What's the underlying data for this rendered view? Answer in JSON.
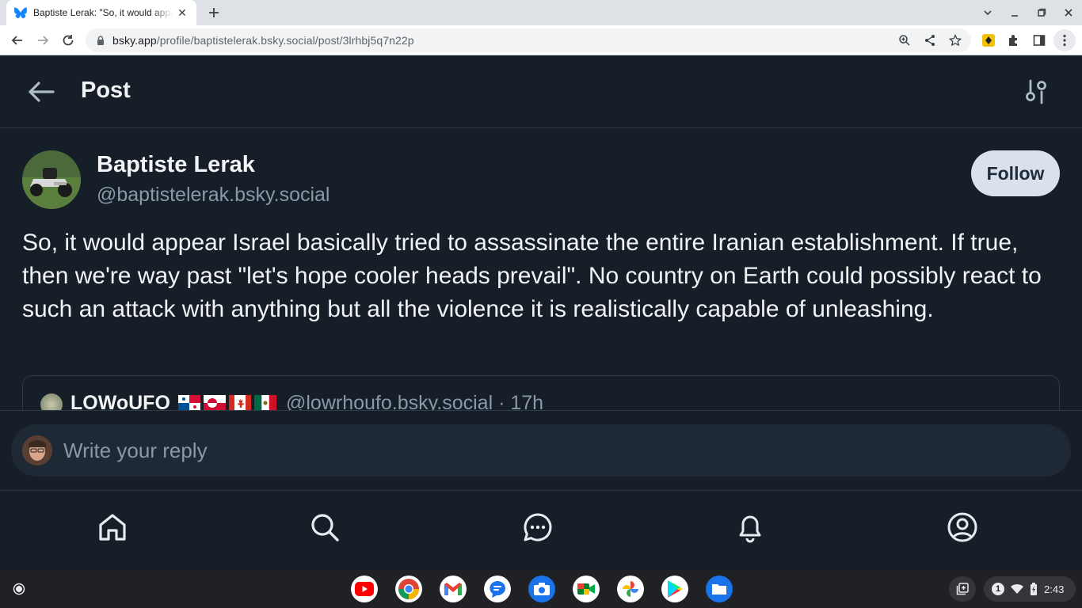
{
  "browser": {
    "tab_title": "Baptiste Lerak: \"So, it would appear Israel basically tried to assassinate",
    "tab_close": "✕",
    "new_tab": "+",
    "url_domain": "bsky.app",
    "url_path": "/profile/baptistelerak.bsky.social/post/3lrhbj5q7n22p"
  },
  "header": {
    "title": "Post",
    "back_icon": "arrow-left-icon",
    "settings_icon": "sliders-icon"
  },
  "post": {
    "author_name": "Baptiste Lerak",
    "author_handle": "@baptistelerak.bsky.social",
    "follow_label": "Follow",
    "text": "So, it would appear Israel basically tried to assassinate the entire Iranian establishment. If true, then we're way past \"let's hope cooler heads prevail\". No country on Earth could possibly react to such an attack with anything but all the violence it is realistically capable of unleashing.",
    "quote": {
      "name": "LOWoUFO",
      "flags": [
        "panama-flag",
        "greenland-flag",
        "canada-flag",
        "mexico-flag"
      ],
      "handle": "@lowrhoufo.bsky.social · 17h"
    }
  },
  "reply": {
    "placeholder": "Write your reply"
  },
  "bottom_nav": {
    "items": [
      "home-icon",
      "search-icon",
      "chat-icon",
      "bell-icon",
      "profile-icon"
    ]
  },
  "shelf": {
    "apps": [
      "youtube",
      "chrome",
      "gmail",
      "messages",
      "camera",
      "meet",
      "photos",
      "play-store",
      "files"
    ],
    "notif_count": "1",
    "time": "2:43"
  },
  "colors": {
    "background": "#161e27",
    "border": "#2e3a48",
    "text": "#f1f3f5",
    "muted": "#8a98ab",
    "follow_bg": "#d8e1ec"
  }
}
